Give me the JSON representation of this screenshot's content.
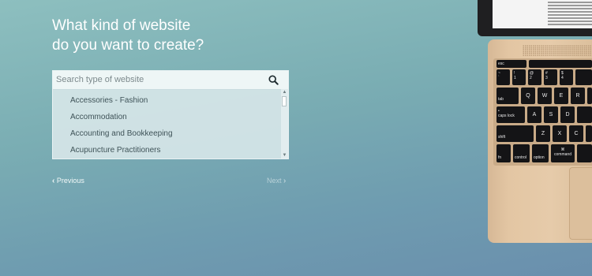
{
  "heading": {
    "line1": "What kind of website",
    "line2": "do you want to create?"
  },
  "search": {
    "placeholder": "Search type of website",
    "value": ""
  },
  "list": {
    "items": [
      "Accessories - Fashion",
      "Accommodation",
      "Accounting and Bookkeeping",
      "Acupuncture Practitioners"
    ]
  },
  "nav": {
    "previous_label": "Previous",
    "next_label": "Next"
  },
  "keyboard": {
    "esc": "esc",
    "tilde": "~",
    "backtick": "`",
    "excl": "!",
    "one": "1",
    "at": "@",
    "two": "2",
    "hash": "#",
    "three": "3",
    "dollar": "$",
    "four": "4",
    "tab": "tab",
    "q": "Q",
    "w": "W",
    "e": "E",
    "r": "R",
    "caps": "caps lock",
    "a": "A",
    "s": "S",
    "d": "D",
    "shift": "shift",
    "z": "Z",
    "x": "X",
    "c": "C",
    "fn": "fn",
    "control": "control",
    "option": "option",
    "command": "command",
    "cmd_symbol": "⌘"
  },
  "colors": {
    "background_top": "#8dbfbf",
    "background_bottom": "#6a8fad",
    "heading_text": "#ffffff",
    "laptop_gold": "#e3c6a3",
    "key_black": "#141416"
  }
}
